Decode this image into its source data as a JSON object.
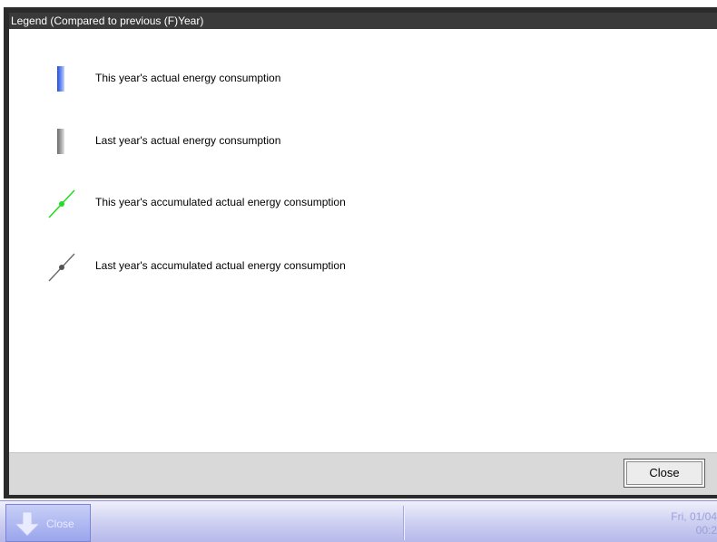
{
  "dialog": {
    "title": "Legend (Compared to previous (F)Year)",
    "close_label": "Close"
  },
  "legend": [
    {
      "icon": "blue-bar-icon",
      "label": "This year's actual energy consumption"
    },
    {
      "icon": "gray-bar-icon",
      "label": "Last year's actual energy consumption"
    },
    {
      "icon": "green-line-marker-icon",
      "label": "This year's accumulated actual energy consumption"
    },
    {
      "icon": "gray-line-marker-icon",
      "label": "Last year's accumulated actual energy consumption"
    }
  ],
  "taskbar": {
    "close_label": "Close",
    "date": "Fri, 01/04",
    "time": "00:2"
  },
  "colors": {
    "this_year_bar": "#3a63ea",
    "last_year_bar": "#8c8c8c",
    "this_year_line": "#22dd22",
    "last_year_line": "#6a6a6a"
  }
}
